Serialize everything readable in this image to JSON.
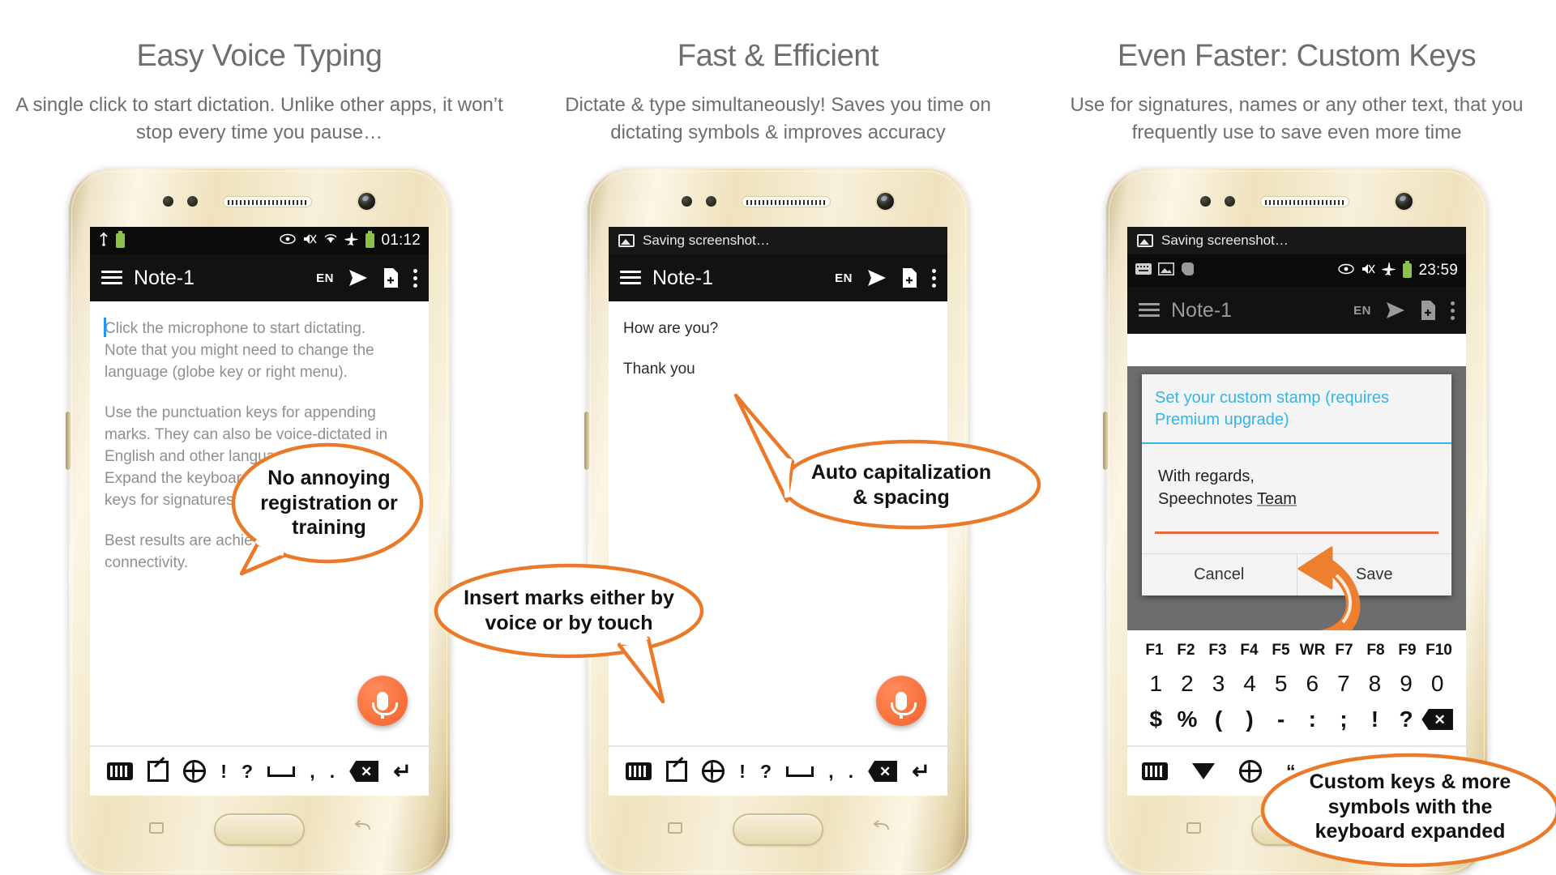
{
  "columns": [
    {
      "id": "col-easy-voice-typing",
      "headline": "Easy Voice Typing",
      "subhead": "A single click to start dictation. Unlike other apps, it won’t stop every time you pause…",
      "phone": {
        "statusbar": {
          "clock": "01:12",
          "left_icons": [
            "usb-icon",
            "battery-saver-icon"
          ],
          "right_icons": [
            "eye-icon",
            "mute-icon",
            "wifi-icon",
            "airplane-mode-icon",
            "battery-icon"
          ]
        },
        "notification": null,
        "appbar": {
          "menu_icon": "hamburger-icon",
          "title": "Note-1",
          "language": "EN",
          "send_icon": "send-icon",
          "new_note_icon": "new-document-icon",
          "overflow_icon": "kebab-menu-icon"
        },
        "note_paragraphs": [
          "Click the microphone to start dictating.\nNote that you might need to change the language (globe key or right menu).",
          "Use the punctuation keys for appending marks. They can also be voice-dictated in English and other languages.\nExpand the keyboard for additional & custom keys for signatures, names, etc.",
          "Best results are achieved with internet connectivity."
        ],
        "fab": "microphone-button",
        "keyboard_bar": [
          "keyboard-icon",
          "expand-icon",
          "globe-icon",
          "!",
          "?",
          "space-icon",
          ",",
          ".",
          "backspace-icon",
          "enter-icon"
        ]
      },
      "callout": {
        "text": "No annoying registration or training",
        "color": "#ea7a29"
      }
    },
    {
      "id": "col-fast-efficient",
      "headline": "Fast & Efficient",
      "subhead": "Dictate & type simultaneously! Saves you time on dictating symbols & improves accuracy",
      "phone": {
        "statusbar": null,
        "notification": "Saving screenshot…",
        "appbar": {
          "menu_icon": "hamburger-icon",
          "title": "Note-1",
          "language": "EN",
          "send_icon": "send-icon",
          "new_note_icon": "new-document-icon",
          "overflow_icon": "kebab-menu-icon"
        },
        "note_paragraphs": [
          "How are you?",
          "Thank you"
        ],
        "fab": "microphone-button",
        "keyboard_bar": [
          "keyboard-icon",
          "expand-icon",
          "globe-icon",
          "!",
          "?",
          "space-icon",
          ",",
          ".",
          "backspace-icon",
          "enter-icon"
        ]
      },
      "callouts": [
        {
          "text": "Auto capitalization & spacing",
          "color": "#ea7a29"
        },
        {
          "text": "Insert marks either by voice or by touch",
          "color": "#ea7a29"
        }
      ]
    },
    {
      "id": "col-custom-keys",
      "headline": "Even Faster: Custom Keys",
      "subhead": "Use for signatures, names or any other text, that you frequently use to save even more time",
      "phone": {
        "notification": "Saving screenshot…",
        "statusbar": {
          "clock": "23:59",
          "left_icons": [
            "keyboard-icon",
            "image-icon",
            "evernote-icon"
          ],
          "right_icons": [
            "eye-icon",
            "mute-icon",
            "airplane-mode-icon",
            "battery-icon"
          ]
        },
        "appbar": {
          "menu_icon": "hamburger-icon",
          "title": "Note-1",
          "language": "EN",
          "send_icon": "send-icon",
          "new_note_icon": "new-document-icon",
          "overflow_icon": "kebab-menu-icon"
        },
        "dialog": {
          "title": "Set your custom stamp (requires Premium upgrade)",
          "field_line1": "With regards,",
          "field_line2": "Speechnotes ",
          "field_line2_underlined": "Team",
          "cancel_label": "Cancel",
          "save_label": "Save"
        },
        "keyboard": {
          "fn_row": [
            "F1",
            "F2",
            "F3",
            "F4",
            "F5",
            "WR",
            "F7",
            "F8",
            "F9",
            "F10"
          ],
          "num_row": [
            "1",
            "2",
            "3",
            "4",
            "5",
            "6",
            "7",
            "8",
            "9",
            "0"
          ],
          "sym_row": [
            "$",
            "%",
            "(",
            ")",
            "-",
            ":",
            ";",
            "!",
            "?",
            "backspace-icon"
          ],
          "bottom_row": [
            "keyboard-icon",
            "collapse-icon",
            "globe-icon",
            "“",
            "”"
          ]
        },
        "arrow": "curved-arrow-up"
      },
      "callout": {
        "text": "Custom keys & more symbols with the keyboard expanded",
        "color": "#ea7a29"
      }
    }
  ],
  "theme": {
    "accent": "#ea7a29",
    "heading_color": "#6e6e6e",
    "appbar_bg": "#121212",
    "dialog_title_color": "#33b5e5",
    "fab_color": "#f4622c",
    "background": "#ffffff"
  }
}
